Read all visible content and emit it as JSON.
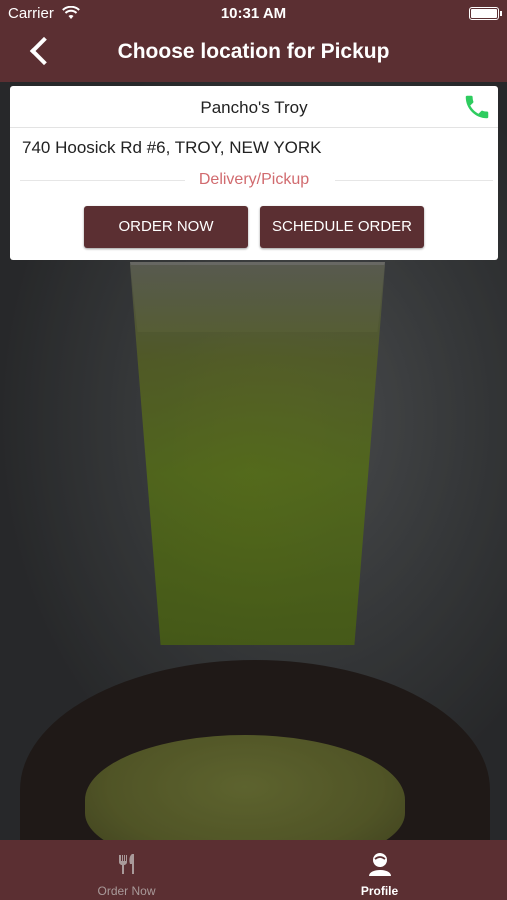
{
  "status_bar": {
    "carrier": "Carrier",
    "time": "10:31 AM"
  },
  "header": {
    "title": "Choose location for Pickup"
  },
  "location_card": {
    "name": "Pancho's Troy",
    "address": "740 Hoosick Rd #6, TROY, NEW YORK",
    "service_type": "Delivery/Pickup",
    "order_now_label": "ORDER NOW",
    "schedule_order_label": "SCHEDULE ORDER",
    "phone_icon": "phone-icon",
    "accent_color": "#2ecc5f"
  },
  "tab_bar": {
    "items": [
      {
        "label": "Order Now",
        "icon": "fork-knife-icon",
        "active": false
      },
      {
        "label": "Profile",
        "icon": "profile-icon",
        "active": true
      }
    ]
  },
  "colors": {
    "brand": "#5b2f32",
    "service_type": "#d16b6f"
  }
}
